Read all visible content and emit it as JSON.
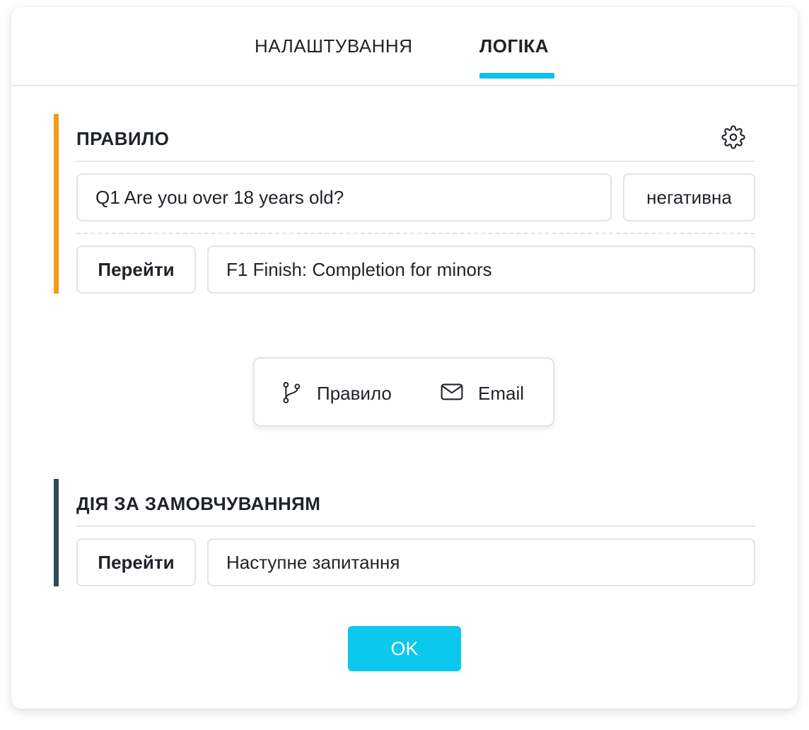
{
  "tabs": {
    "settings": "НАЛАШТУВАННЯ",
    "logic": "ЛОГІКА",
    "active": "logic"
  },
  "rule": {
    "title": "ПРАВИЛО",
    "question": "Q1 Are you over 18 years old?",
    "condition": "негативна",
    "action_label": "Перейти",
    "target": "F1 Finish: Completion for minors"
  },
  "add_menu": {
    "rule_label": "Правило",
    "email_label": "Email"
  },
  "default_action": {
    "title": "ДІЯ ЗА ЗАМОВЧУВАННЯМ",
    "action_label": "Перейти",
    "target": "Наступне запитання"
  },
  "ok_label": "OK",
  "colors": {
    "accent": "#0cc0e6",
    "rule_bar": "#f39c12",
    "default_bar": "#2d4a5c",
    "ok_button": "#0cc7ee"
  },
  "icons": {
    "rule_settings": "gear-icon",
    "add_rule": "branch-icon",
    "add_email": "envelope-icon"
  }
}
